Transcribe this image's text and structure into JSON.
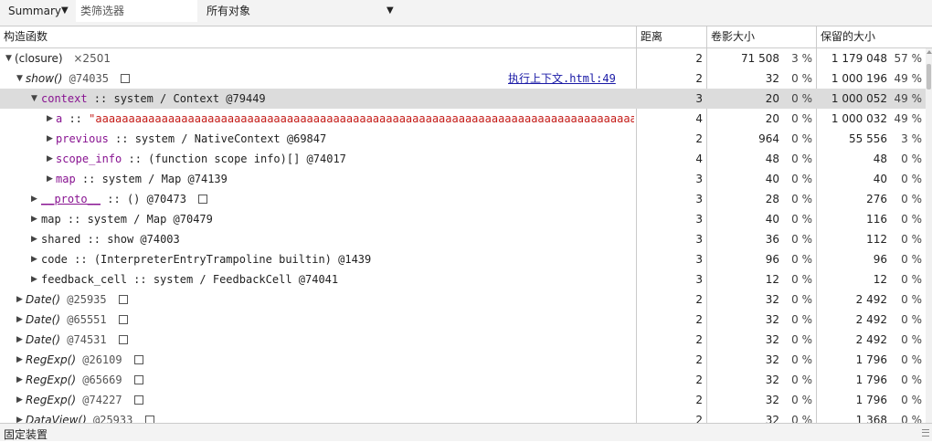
{
  "toolbar": {
    "view_label": "Summary",
    "class_filter_placeholder": "类筛选器",
    "object_filter_label": "所有对象"
  },
  "columns": {
    "constructor": "构造函数",
    "distance": "距离",
    "shallow_size": "卷影大小",
    "retained_size": "保留的大小"
  },
  "rows": [
    {
      "label": "(closure)",
      "count": "×2501",
      "distance": "2",
      "shallow": "71 508",
      "shallow_pct": "3 %",
      "retained": "1 179 048",
      "retained_pct": "57 %"
    },
    {
      "label": "show()",
      "id": "@74035",
      "link": "执行上下文.html:49",
      "distance": "2",
      "shallow": "32",
      "shallow_pct": "0 %",
      "retained": "1 000 196",
      "retained_pct": "49 %"
    },
    {
      "label": "context",
      "sep": " :: ",
      "type": "system / Context @79449",
      "distance": "3",
      "shallow": "20",
      "shallow_pct": "0 %",
      "retained": "1 000 052",
      "retained_pct": "49 %"
    },
    {
      "label": "a",
      "sep": " :: ",
      "type": "\"aaaaaaaaaaaaaaaaaaaaaaaaaaaaaaaaaaaaaaaaaaaaaaaaaaaaaaaaaaaaaaaaaaaaaaaaaaaaaaaaaaaaaaaaaaaaaaaaaaaaaaaaaaaaaaaa",
      "distance": "4",
      "shallow": "20",
      "shallow_pct": "0 %",
      "retained": "1 000 032",
      "retained_pct": "49 %"
    },
    {
      "label": "previous",
      "sep": " :: ",
      "type": "system / NativeContext @69847",
      "distance": "2",
      "shallow": "964",
      "shallow_pct": "0 %",
      "retained": "55 556",
      "retained_pct": "3 %"
    },
    {
      "label": "scope_info",
      "sep": " :: ",
      "type": "(function scope info)[] @74017",
      "distance": "4",
      "shallow": "48",
      "shallow_pct": "0 %",
      "retained": "48",
      "retained_pct": "0 %"
    },
    {
      "label": "map",
      "sep": " :: ",
      "type": "system / Map @74139",
      "distance": "3",
      "shallow": "40",
      "shallow_pct": "0 %",
      "retained": "40",
      "retained_pct": "0 %"
    },
    {
      "label": "__proto__",
      "sep": " :: ",
      "type": "() @70473",
      "distance": "3",
      "shallow": "28",
      "shallow_pct": "0 %",
      "retained": "276",
      "retained_pct": "0 %"
    },
    {
      "label": "map",
      "sep": " :: ",
      "type": "system / Map @70479",
      "distance": "3",
      "shallow": "40",
      "shallow_pct": "0 %",
      "retained": "116",
      "retained_pct": "0 %"
    },
    {
      "label": "shared",
      "sep": " :: ",
      "type": "show @74003",
      "distance": "3",
      "shallow": "36",
      "shallow_pct": "0 %",
      "retained": "112",
      "retained_pct": "0 %"
    },
    {
      "label": "code",
      "sep": " :: ",
      "type": "(InterpreterEntryTrampoline builtin) @1439",
      "distance": "3",
      "shallow": "96",
      "shallow_pct": "0 %",
      "retained": "96",
      "retained_pct": "0 %"
    },
    {
      "label": "feedback_cell",
      "sep": " :: ",
      "type": "system / FeedbackCell @74041",
      "distance": "3",
      "shallow": "12",
      "shallow_pct": "0 %",
      "retained": "12",
      "retained_pct": "0 %"
    },
    {
      "label": "Date()",
      "id": "@25935",
      "distance": "2",
      "shallow": "32",
      "shallow_pct": "0 %",
      "retained": "2 492",
      "retained_pct": "0 %"
    },
    {
      "label": "Date()",
      "id": "@65551",
      "distance": "2",
      "shallow": "32",
      "shallow_pct": "0 %",
      "retained": "2 492",
      "retained_pct": "0 %"
    },
    {
      "label": "Date()",
      "id": "@74531",
      "distance": "2",
      "shallow": "32",
      "shallow_pct": "0 %",
      "retained": "2 492",
      "retained_pct": "0 %"
    },
    {
      "label": "RegExp()",
      "id": "@26109",
      "distance": "2",
      "shallow": "32",
      "shallow_pct": "0 %",
      "retained": "1 796",
      "retained_pct": "0 %"
    },
    {
      "label": "RegExp()",
      "id": "@65669",
      "distance": "2",
      "shallow": "32",
      "shallow_pct": "0 %",
      "retained": "1 796",
      "retained_pct": "0 %"
    },
    {
      "label": "RegExp()",
      "id": "@74227",
      "distance": "2",
      "shallow": "32",
      "shallow_pct": "0 %",
      "retained": "1 796",
      "retained_pct": "0 %"
    },
    {
      "label": "DataView()",
      "id": "@25933",
      "distance": "2",
      "shallow": "32",
      "shallow_pct": "0 %",
      "retained": "1 368",
      "retained_pct": "0 %"
    }
  ],
  "bottom": {
    "title": "固定装置"
  },
  "colors": {
    "selected_row": "#dcdcdc",
    "property_name": "#881391",
    "string_value": "#c41a16",
    "link": "#1a1aa6"
  },
  "icons": {
    "expanded": "triangle-down-icon",
    "collapsed": "triangle-right-icon",
    "object": "object-box-icon"
  }
}
